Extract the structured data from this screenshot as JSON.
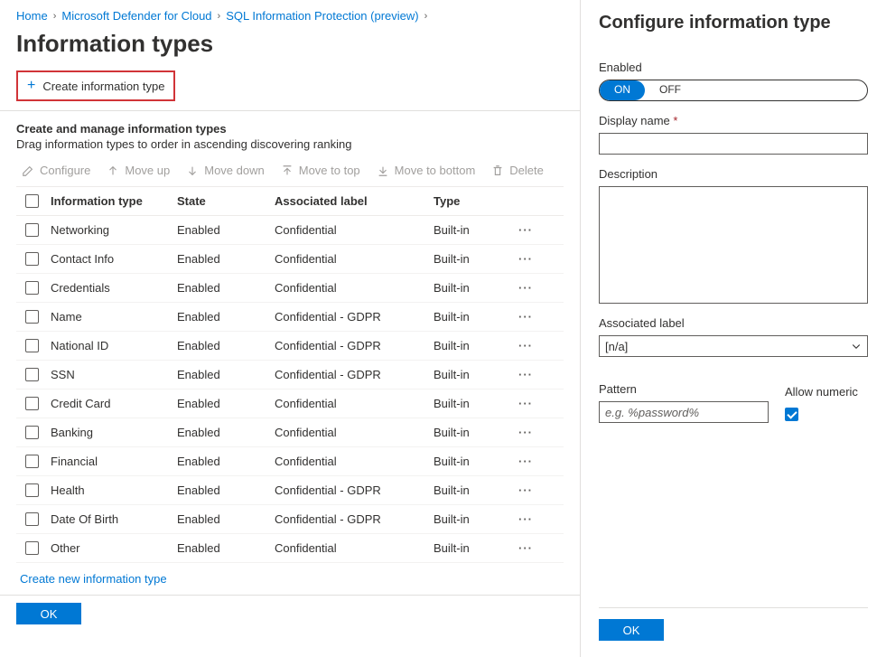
{
  "breadcrumbs": [
    "Home",
    "Microsoft Defender for Cloud",
    "SQL Information Protection (preview)"
  ],
  "page_title": "Information types",
  "create_cmd": "Create information type",
  "section": {
    "title": "Create and manage information types",
    "desc": "Drag information types to order in ascending discovering ranking"
  },
  "toolbar": {
    "configure": "Configure",
    "move_up": "Move up",
    "move_down": "Move down",
    "move_top": "Move to top",
    "move_bottom": "Move to bottom",
    "delete": "Delete"
  },
  "columns": {
    "c1": "Information type",
    "c2": "State",
    "c3": "Associated label",
    "c4": "Type"
  },
  "rows": [
    {
      "name": "Networking",
      "state": "Enabled",
      "label": "Confidential",
      "type": "Built-in"
    },
    {
      "name": "Contact Info",
      "state": "Enabled",
      "label": "Confidential",
      "type": "Built-in"
    },
    {
      "name": "Credentials",
      "state": "Enabled",
      "label": "Confidential",
      "type": "Built-in"
    },
    {
      "name": "Name",
      "state": "Enabled",
      "label": "Confidential - GDPR",
      "type": "Built-in"
    },
    {
      "name": "National ID",
      "state": "Enabled",
      "label": "Confidential - GDPR",
      "type": "Built-in"
    },
    {
      "name": "SSN",
      "state": "Enabled",
      "label": "Confidential - GDPR",
      "type": "Built-in"
    },
    {
      "name": "Credit Card",
      "state": "Enabled",
      "label": "Confidential",
      "type": "Built-in"
    },
    {
      "name": "Banking",
      "state": "Enabled",
      "label": "Confidential",
      "type": "Built-in"
    },
    {
      "name": "Financial",
      "state": "Enabled",
      "label": "Confidential",
      "type": "Built-in"
    },
    {
      "name": "Health",
      "state": "Enabled",
      "label": "Confidential - GDPR",
      "type": "Built-in"
    },
    {
      "name": "Date Of Birth",
      "state": "Enabled",
      "label": "Confidential - GDPR",
      "type": "Built-in"
    },
    {
      "name": "Other",
      "state": "Enabled",
      "label": "Confidential",
      "type": "Built-in"
    }
  ],
  "link_create_new": "Create new information type",
  "ok": "OK",
  "panel": {
    "title": "Configure information type",
    "enabled_label": "Enabled",
    "toggle_on": "ON",
    "toggle_off": "OFF",
    "display_name_label": "Display name",
    "description_label": "Description",
    "associated_label": "Associated label",
    "associated_value": "[n/a]",
    "pattern_label": "Pattern",
    "pattern_placeholder": "e.g. %password%",
    "allow_numeric_label": "Allow numeric",
    "ok": "OK"
  }
}
